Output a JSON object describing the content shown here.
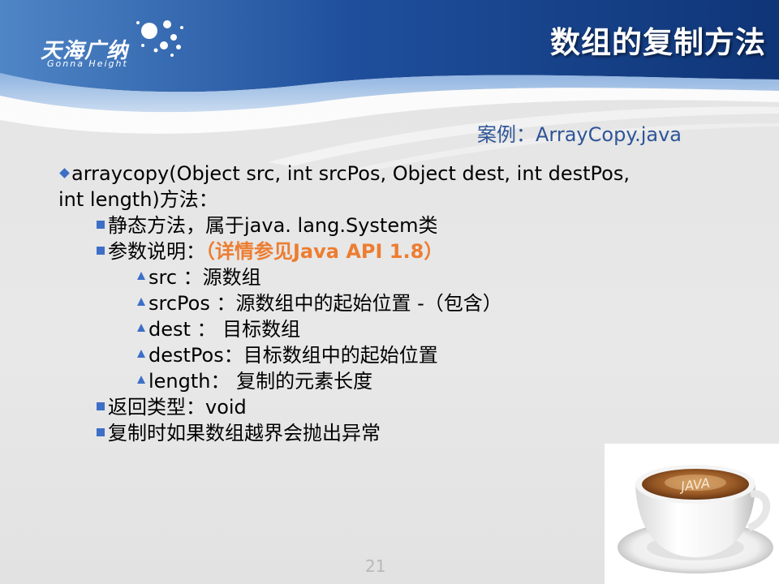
{
  "header": {
    "title": "数组的复制方法",
    "logo_cn": "天海广纳",
    "logo_en": "Gonna Height"
  },
  "case_ref": "案例：ArrayCopy.java",
  "content": {
    "line1a": "arraycopy(Object src, int srcPos, Object dest, int destPos,",
    "line1b": "int length)方法：",
    "static_method": "静态方法，属于java. lang.System类",
    "params_label": "参数说明：",
    "params_note": "（详情参见Java API 1.8）",
    "param_src": "src ：源数组",
    "param_srcPos": "srcPos ：源数组中的起始位置 -（包含）",
    "param_dest": "dest ： 目标数组",
    "param_destPos": "destPos：目标数组中的起始位置",
    "param_length": "length： 复制的元素长度",
    "return_type": "返回类型：void",
    "exception": "复制时如果数组越界会抛出异常"
  },
  "page_number": "21",
  "colors": {
    "header_blue": "#1f4f9c",
    "bullet": "#3d6fc7",
    "case_ref": "#2f5597",
    "highlight": "#ed7d31"
  },
  "images": {
    "coffee": "java-coffee-cup-image"
  }
}
